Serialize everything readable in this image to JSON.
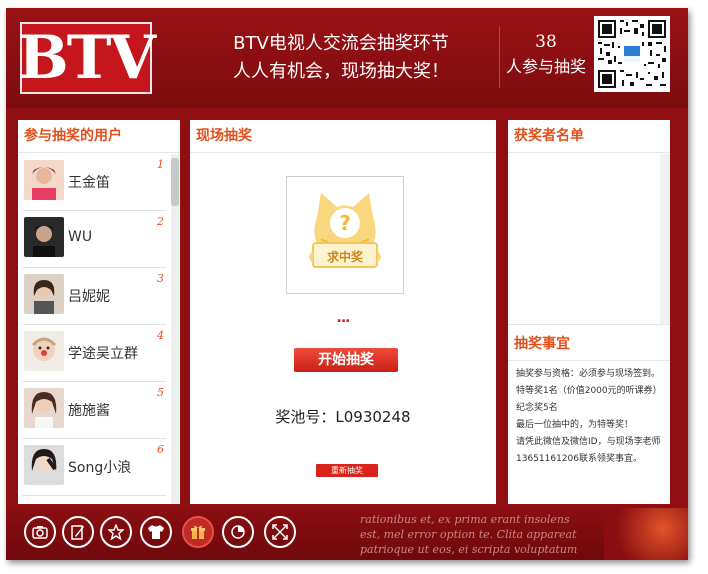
{
  "header": {
    "logo_text": "BTV",
    "slogan_line1": "BTV电视人交流会抽奖环节",
    "slogan_line2": "人人有机会，现场抽大奖！",
    "participant_count": "38",
    "participant_label": "人参与抽奖"
  },
  "left_panel": {
    "title": "参与抽奖的用户",
    "users": [
      {
        "name": "王金笛",
        "rank": "1"
      },
      {
        "name": "WU",
        "rank": "2"
      },
      {
        "name": "吕妮妮",
        "rank": "3"
      },
      {
        "name": "学途吴立群",
        "rank": "4"
      },
      {
        "name": "施施酱",
        "rank": "5"
      },
      {
        "name": "Song小浪",
        "rank": "6"
      }
    ]
  },
  "center_panel": {
    "title": "现场抽奖",
    "prize_caption": "求中奖",
    "dots": "...",
    "start_button": "开始抽奖",
    "pool_label": "奖池号：L0930248",
    "reset_button": "重新抽奖"
  },
  "right_panel": {
    "winners_title": "获奖者名单",
    "rules_title": "抽奖事宜",
    "rules": [
      "抽奖参与资格：必须参与现场签到。",
      "特等奖1名（价值2000元的听课券）",
      "纪念奖5名",
      "最后一位抽中的，为特等奖！",
      "请凭此微信及微信ID，与现场李老师",
      "13651161206联系领奖事宜。"
    ]
  },
  "footer": {
    "tools": [
      "camera-icon",
      "edit-icon",
      "star-icon",
      "tshirt-icon",
      "gift-icon",
      "pie-chart-icon",
      "fullscreen-icon"
    ],
    "latin_lines": [
      "rationibus et, ex prima erant insolens",
      "est, mel error option te. Clita appareat",
      "patrioque ut eos, ei scripta voluptatum"
    ]
  },
  "colors": {
    "brand_red": "#8f0f12",
    "accent_orange": "#e0501e",
    "button_red": "#d8231b"
  }
}
